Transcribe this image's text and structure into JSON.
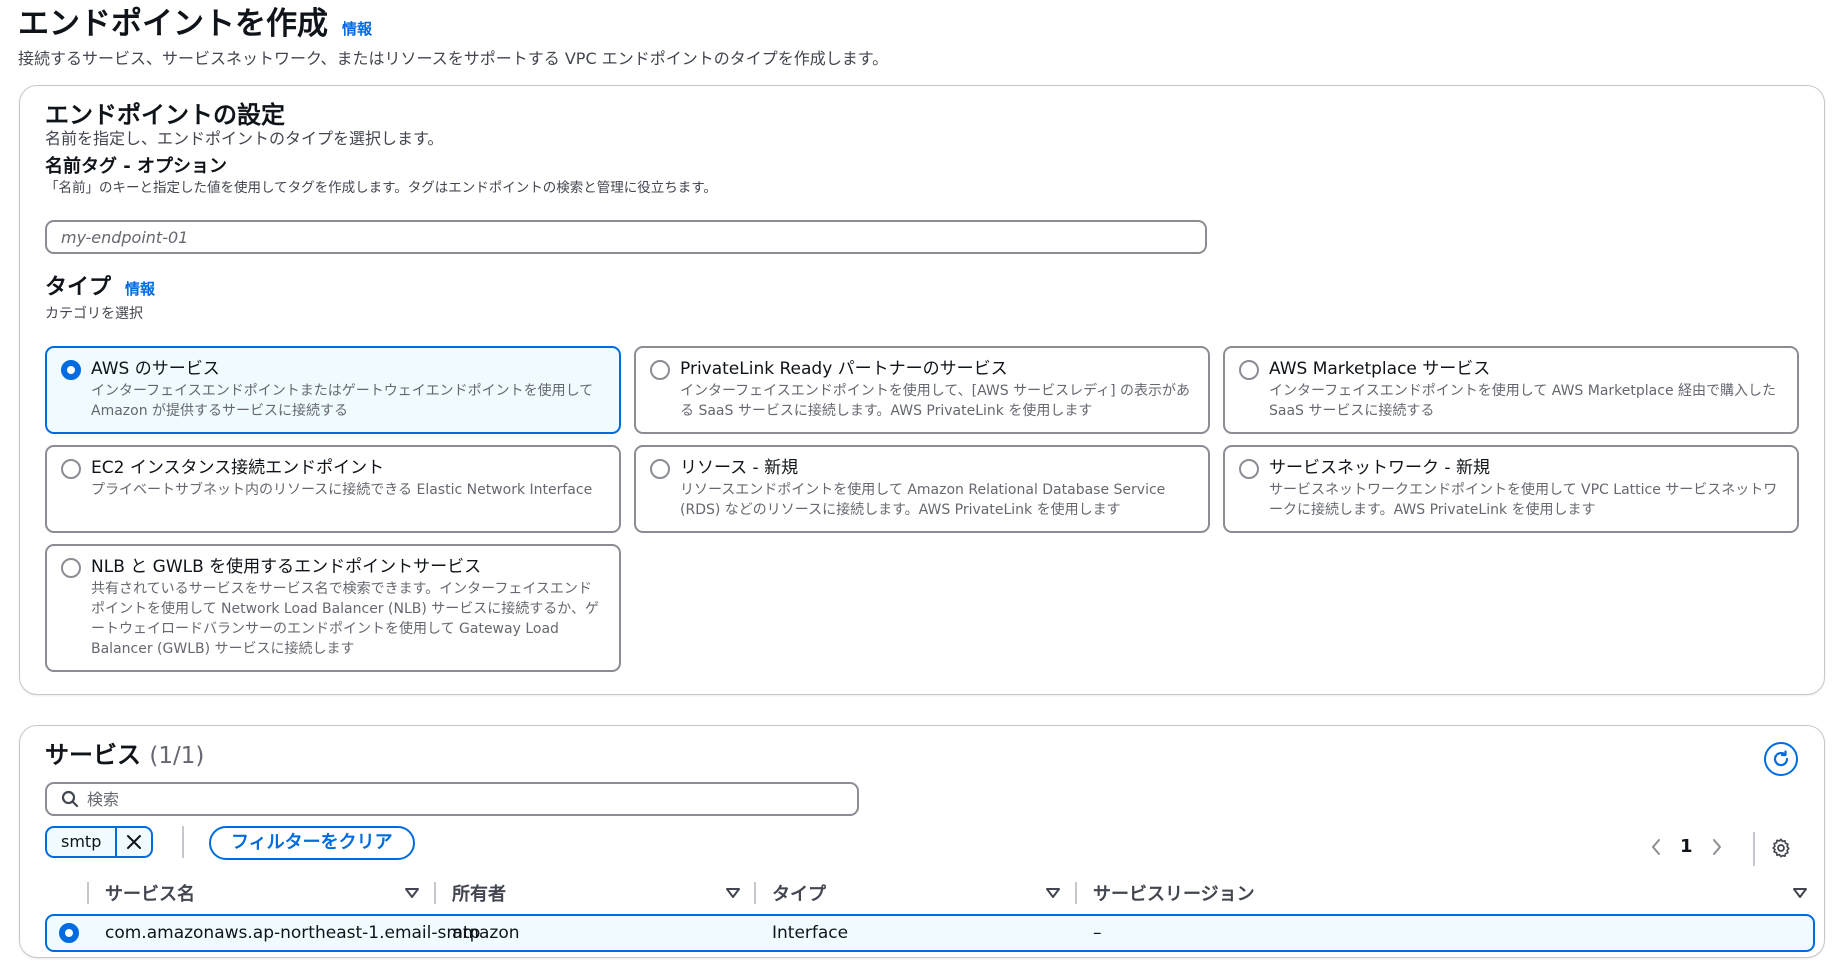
{
  "header": {
    "title": "エンドポイントを作成",
    "info": "情報",
    "description": "接続するサービス、サービスネットワーク、またはリソースをサポートする VPC エンドポイントのタイプを作成します。"
  },
  "settings": {
    "title": "エンドポイントの設定",
    "description": "名前を指定し、エンドポイントのタイプを選択します。",
    "name_tag": {
      "label": "名前タグ - オプション",
      "description": "「名前」のキーと指定した値を使用してタグを作成します。タグはエンドポイントの検索と管理に役立ちます。",
      "placeholder": "my-endpoint-01",
      "value": ""
    },
    "type": {
      "label": "タイプ",
      "info": "情報",
      "description": "カテゴリを選択",
      "selected": "aws",
      "options": [
        {
          "id": "aws",
          "title": "AWS のサービス",
          "desc": "インターフェイスエンドポイントまたはゲートウェイエンドポイントを使用して Amazon が提供するサービスに接続する"
        },
        {
          "id": "privatelink",
          "title": "PrivateLink Ready パートナーのサービス",
          "desc": "インターフェイスエンドポイントを使用して、[AWS サービスレディ] の表示がある SaaS サービスに接続します。AWS PrivateLink を使用します"
        },
        {
          "id": "marketplace",
          "title": "AWS Marketplace サービス",
          "desc": "インターフェイスエンドポイントを使用して AWS Marketplace 経由で購入した SaaS サービスに接続する"
        },
        {
          "id": "ec2",
          "title": "EC2 インスタンス接続エンドポイント",
          "desc": "プライベートサブネット内のリソースに接続できる Elastic Network Interface"
        },
        {
          "id": "resource",
          "title": "リソース - 新規",
          "desc": "リソースエンドポイントを使用して Amazon Relational Database Service (RDS) などのリソースに接続します。AWS PrivateLink を使用します"
        },
        {
          "id": "servicenetwork",
          "title": "サービスネットワーク - 新規",
          "desc": "サービスネットワークエンドポイントを使用して VPC Lattice サービスネットワークに接続します。AWS PrivateLink を使用します"
        },
        {
          "id": "nlb",
          "title": "NLB と GWLB を使用するエンドポイントサービス",
          "desc": "共有されているサービスをサービス名で検索できます。インターフェイスエンドポイントを使用して Network Load Balancer (NLB) サービスに接続するか、ゲートウェイロードバランサーのエンドポイントを使用して Gateway Load Balancer (GWLB) サービスに接続します"
        }
      ]
    }
  },
  "services": {
    "title": "サービス",
    "count": "(1/1)",
    "search_placeholder": "検索",
    "filter_token": "smtp",
    "clear_filter": "フィルターをクリア",
    "page": "1",
    "columns": [
      "サービス名",
      "所有者",
      "タイプ",
      "サービスリージョン"
    ],
    "rows": [
      {
        "name": "com.amazonaws.ap-northeast-1.email-smtp",
        "owner": "amazon",
        "type": "Interface",
        "region": "–"
      }
    ]
  },
  "colors": {
    "accent": "#006ce0",
    "selected_bg": "#f0fbff",
    "border": "#8c8c94"
  }
}
